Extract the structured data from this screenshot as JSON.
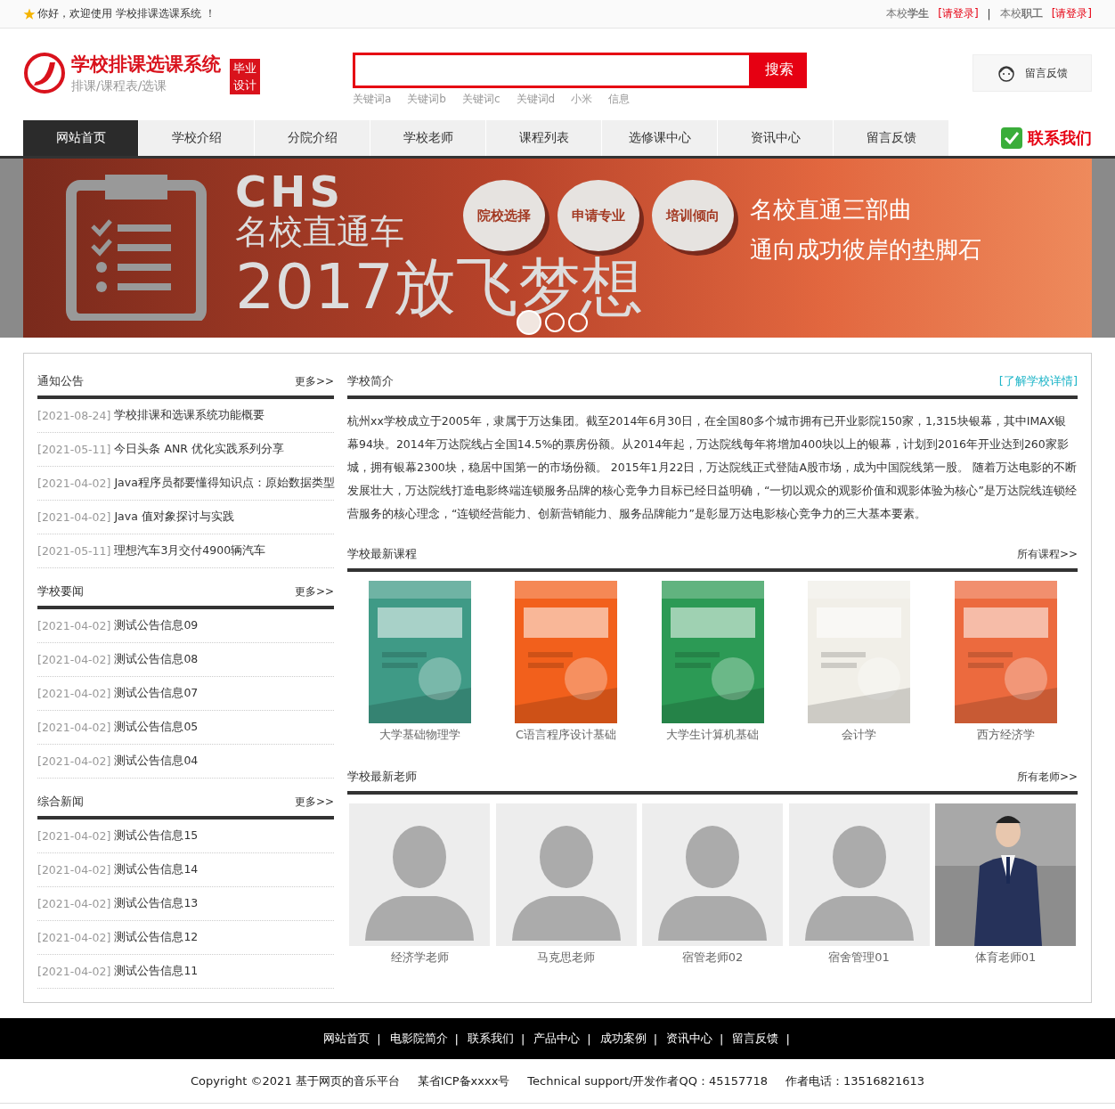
{
  "top_bar": {
    "welcome": "你好，欢迎使用 学校排课选课系统 ！",
    "logins": [
      {
        "label": "本校**学生**",
        "link": "[请登录]"
      },
      {
        "label": "本校**职工**",
        "link": "[请登录]"
      }
    ],
    "separator": "|"
  },
  "header": {
    "title": "学校排课选课系统",
    "subtitle": "排课/课程表/选课",
    "badge": [
      "毕业",
      "设计"
    ],
    "search": {
      "button": "搜索",
      "keywords": [
        "关键词a",
        "关键词b",
        "关键词c",
        "关键词d",
        "小米",
        "信息"
      ]
    },
    "feedback": "留言反馈"
  },
  "nav": {
    "items": [
      {
        "label": "网站首页",
        "selected": true
      },
      {
        "label": "学校介绍",
        "selected": false
      },
      {
        "label": "分院介绍",
        "selected": false
      },
      {
        "label": "学校老师",
        "selected": false
      },
      {
        "label": "课程列表",
        "selected": false
      },
      {
        "label": "选修课中心",
        "selected": false
      },
      {
        "label": "资讯中心",
        "selected": false
      },
      {
        "label": "留言反馈",
        "selected": false
      }
    ],
    "contact": "联系我们"
  },
  "banner": {
    "brand": "CHS",
    "title": "名校直通车",
    "headline": "2017放飞梦想",
    "bubbles": [
      "院校选择",
      "申请专业",
      "培训倾向"
    ],
    "lines": [
      "名校直通三部曲",
      "通向成功彼岸的垫脚石"
    ],
    "dots": [
      {
        "selected": true
      },
      {
        "selected": false
      },
      {
        "selected": false
      }
    ]
  },
  "left_sections": [
    {
      "title": "通知公告",
      "more": "更多>>",
      "items": [
        {
          "date": "[2021-08-24]",
          "title": "学校排课和选课系统功能概要"
        },
        {
          "date": "[2021-05-11]",
          "title": "今日头条 ANR 优化实践系列分享"
        },
        {
          "date": "[2021-04-02]",
          "title": "Java程序员都要懂得知识点：原始数据类型"
        },
        {
          "date": "[2021-04-02]",
          "title": "Java 值对象探讨与实践"
        },
        {
          "date": "[2021-05-11]",
          "title": "理想汽车3月交付4900辆汽车"
        }
      ]
    },
    {
      "title": "学校要闻",
      "more": "更多>>",
      "items": [
        {
          "date": "[2021-04-02]",
          "title": "测试公告信息09"
        },
        {
          "date": "[2021-04-02]",
          "title": "测试公告信息08"
        },
        {
          "date": "[2021-04-02]",
          "title": "测试公告信息07"
        },
        {
          "date": "[2021-04-02]",
          "title": "测试公告信息05"
        },
        {
          "date": "[2021-04-02]",
          "title": "测试公告信息04"
        }
      ]
    },
    {
      "title": "综合新闻",
      "more": "更多>>",
      "items": [
        {
          "date": "[2021-04-02]",
          "title": "测试公告信息15"
        },
        {
          "date": "[2021-04-02]",
          "title": "测试公告信息14"
        },
        {
          "date": "[2021-04-02]",
          "title": "测试公告信息13"
        },
        {
          "date": "[2021-04-02]",
          "title": "测试公告信息12"
        },
        {
          "date": "[2021-04-02]",
          "title": "测试公告信息11"
        }
      ]
    }
  ],
  "intro": {
    "title": "学校简介",
    "link": "[了解学校详情]",
    "text": "杭州xx学校成立于2005年，隶属于万达集团。截至2014年6月30日，在全国80多个城市拥有已开业影院150家，1,315块银幕，其中IMAX银幕94块。2014年万达院线占全国14.5%的票房份额。从2014年起，万达院线每年将增加400块以上的银幕，计划到2016年开业达到260家影城，拥有银幕2300块，稳居中国第一的市场份额。 2015年1月22日，万达院线正式登陆A股市场，成为中国院线第一股。 随着万达电影的不断发展壮大，万达院线打造电影终端连锁服务品牌的核心竞争力目标已经日益明确，“一切以观众的观影价值和观影体验为核心”是万达院线连锁经营服务的核心理念，“连锁经营能力、创新营销能力、服务品牌能力”是彰显万达电影核心竞争力的三大基本要素。"
  },
  "courses": {
    "title": "学校最新课程",
    "more": "所有课程>>",
    "items": [
      {
        "name": "大学基础物理学",
        "color": "#3f9a86"
      },
      {
        "name": "C语言程序设计基础",
        "color": "#f2601c"
      },
      {
        "name": "大学生计算机基础",
        "color": "#2c9a55"
      },
      {
        "name": "会计学",
        "color": "#f1efe8"
      },
      {
        "name": "西方经济学",
        "color": "#ec6a3e"
      }
    ]
  },
  "teachers": {
    "title": "学校最新老师",
    "more": "所有老师>>",
    "items": [
      {
        "name": "经济学老师",
        "kind": "avatar"
      },
      {
        "name": "马克思老师",
        "kind": "avatar"
      },
      {
        "name": "宿管老师02",
        "kind": "avatar"
      },
      {
        "name": "宿舍管理01",
        "kind": "avatar"
      },
      {
        "name": "体育老师01",
        "kind": "picture"
      }
    ]
  },
  "footer": {
    "links": [
      "网站首页",
      "电影院简介",
      "联系我们",
      "产品中心",
      "成功案例",
      "资讯中心",
      "留言反馈"
    ],
    "separator": "|",
    "copyright": [
      "Copyright ©2021 基于网页的音乐平台",
      "某省ICP备xxxx号",
      "Technical support/开发作者QQ：45157718",
      "作者电话：13516821613"
    ]
  }
}
